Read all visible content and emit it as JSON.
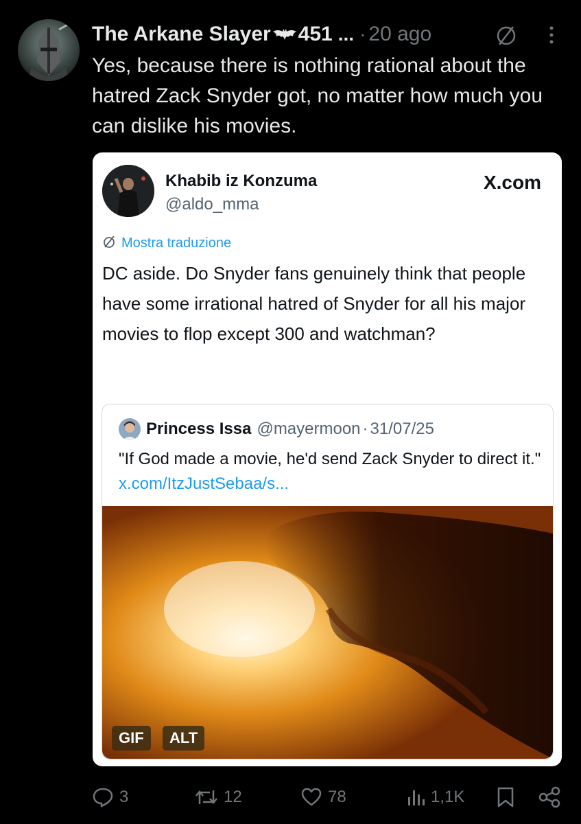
{
  "post": {
    "author_name": "The Arkane Slayer",
    "author_badge": "451",
    "name_truncation": "...",
    "separator": "·",
    "timestamp": "20 ago",
    "text": "Yes, because there is nothing rational about the hatred Zack Snyder got, no matter how much you can dislike his movies."
  },
  "quote": {
    "author_name": "Khabib iz Konzuma",
    "handle": "@aldo_mma",
    "source": "X.com",
    "translate_label": "Mostra traduzione",
    "text": "DC aside. Do Snyder fans genuinely think that people have some irrational hatred of Snyder for all his major movies to flop except 300 and watchman?",
    "inner": {
      "author_name": "Princess Issa",
      "handle": "@mayermoon",
      "separator": "·",
      "date": "31/07/25",
      "text": "\"If God made a movie, he'd send Zack Snyder to direct it.\"",
      "link": "x.com/ItzJustSebaa/s...",
      "badges": {
        "gif": "GIF",
        "alt": "ALT"
      }
    }
  },
  "actions": {
    "replies": "3",
    "reposts": "12",
    "likes": "78",
    "views": "1,1K"
  },
  "colors": {
    "background": "#000000",
    "text_primary": "#e7e9ea",
    "text_secondary": "#71767b",
    "link": "#1d9bf0",
    "card_bg": "#ffffff"
  },
  "icons": [
    "translate-icon",
    "more-icon",
    "reply-icon",
    "repost-icon",
    "like-icon",
    "views-icon",
    "bookmark-icon",
    "share-icon",
    "bat-icon"
  ]
}
